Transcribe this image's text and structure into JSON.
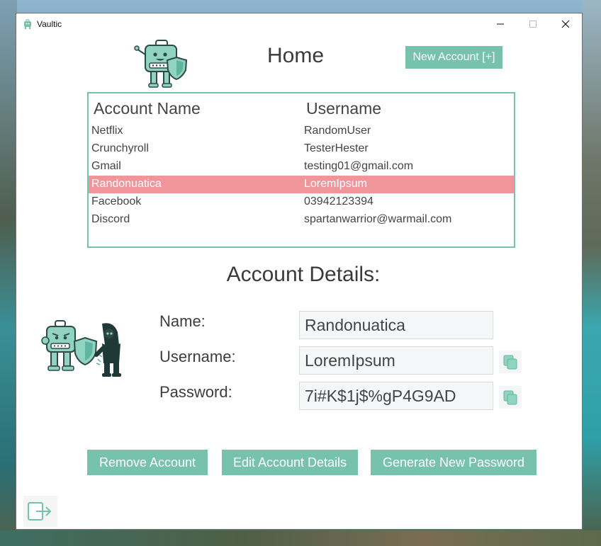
{
  "window": {
    "title": "Vaultic",
    "min_icon": "minimize-icon",
    "max_icon": "maximize-icon",
    "close_icon": "close-icon"
  },
  "header": {
    "title": "Home",
    "new_account_label": "New Account [+]"
  },
  "accounts": {
    "columns": [
      "Account Name",
      "Username"
    ],
    "rows": [
      {
        "name": "Netflix",
        "username": "RandomUser",
        "selected": false
      },
      {
        "name": "Crunchyroll",
        "username": "TesterHester",
        "selected": false
      },
      {
        "name": "Gmail",
        "username": "testing01@gmail.com",
        "selected": false
      },
      {
        "name": "Randonuatica",
        "username": "LoremIpsum",
        "selected": true
      },
      {
        "name": "Facebook",
        "username": "03942123394",
        "selected": false
      },
      {
        "name": "Discord",
        "username": "spartanwarrior@warmail.com",
        "selected": false
      }
    ]
  },
  "details": {
    "title": "Account Details:",
    "name_label": "Name:",
    "name_value": "Randonuatica",
    "username_label": "Username:",
    "username_value": "LoremIpsum",
    "password_label": "Password:",
    "password_value": "7i#K$1j$%gP4G9AD"
  },
  "actions": {
    "remove_label": "Remove Account",
    "edit_label": "Edit Account Details",
    "generate_label": "Generate New Password"
  },
  "colors": {
    "accent": "#76c2ad",
    "selected_row": "#f0969b",
    "text": "#444444"
  }
}
